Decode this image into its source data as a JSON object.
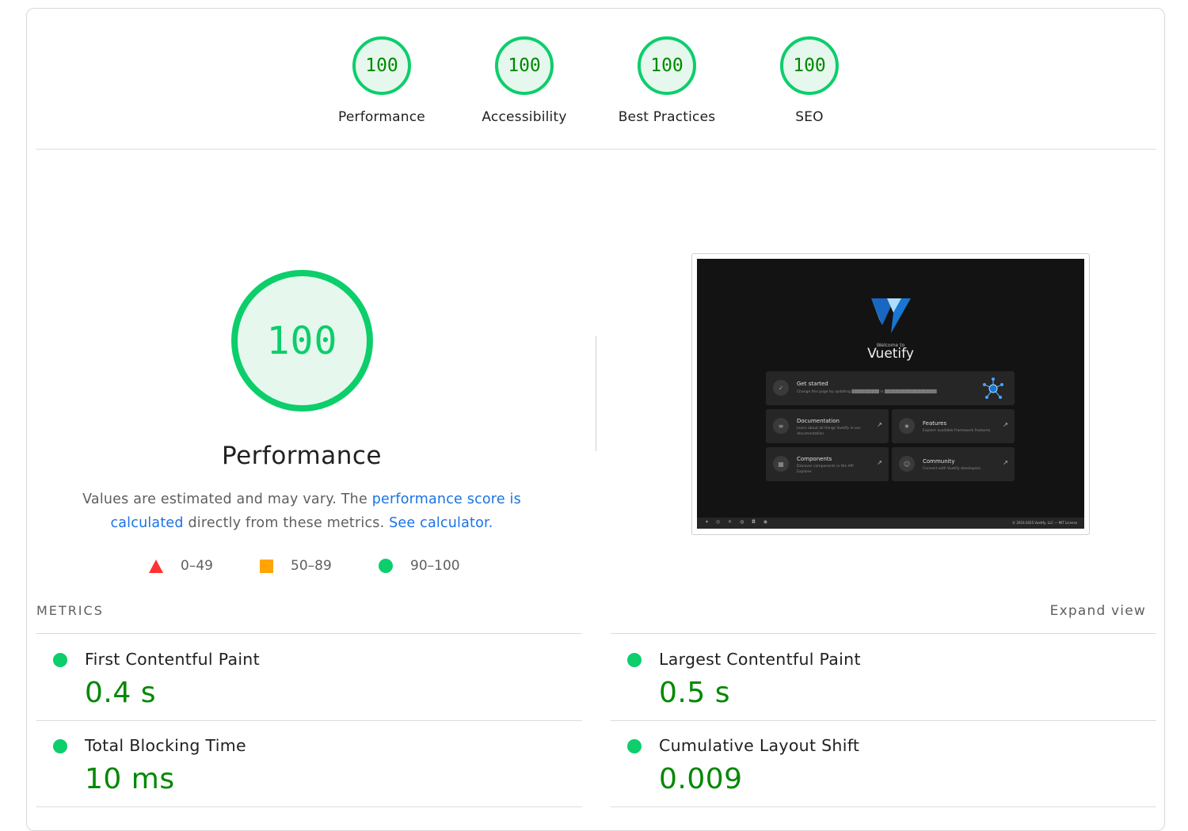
{
  "gauges": [
    {
      "score": "100",
      "label": "Performance"
    },
    {
      "score": "100",
      "label": "Accessibility"
    },
    {
      "score": "100",
      "label": "Best Practices"
    },
    {
      "score": "100",
      "label": "SEO"
    }
  ],
  "main": {
    "score": "100",
    "title": "Performance",
    "desc_text1": "Values are estimated and may vary. The ",
    "desc_link1": "performance score is calculated",
    "desc_text2": " directly from these metrics. ",
    "desc_link2": "See calculator."
  },
  "legend": [
    {
      "range": "0–49",
      "color": "#ff3333",
      "shape": "triangle"
    },
    {
      "range": "50–89",
      "color": "#ffa400",
      "shape": "square"
    },
    {
      "range": "90–100",
      "color": "#0cce6b",
      "shape": "circle"
    }
  ],
  "screenshot": {
    "welcome": "Welcome to",
    "brand": "Vuetify",
    "cards": [
      {
        "title": "Get started",
        "subtitle": "Change this page by updating ▓▓▓▓▓▓▓▓▓▓ in ▓▓▓▓▓▓▓▓▓▓▓▓▓▓▓▓▓▓▓",
        "icon": "check-icon"
      },
      {
        "title": "Documentation",
        "subtitle": "Learn about all things Vuetify in our documentation.",
        "icon": "document-icon"
      },
      {
        "title": "Features",
        "subtitle": "Explore available framework Features.",
        "icon": "star-icon"
      },
      {
        "title": "Components",
        "subtitle": "Discover components in the API Explorer.",
        "icon": "grid-icon"
      },
      {
        "title": "Community",
        "subtitle": "Connect with Vuetify developers.",
        "icon": "people-icon"
      }
    ],
    "footer_icons": "▾ ◎ ✕ ◍ ◘ ◉",
    "footer_copy": "© 2016-2025 Vuetify, LLC — MIT License"
  },
  "metrics": {
    "title": "METRICS",
    "expand_label": "Expand view",
    "items": [
      {
        "label": "First Contentful Paint",
        "value": "0.4 s",
        "status": "pass"
      },
      {
        "label": "Largest Contentful Paint",
        "value": "0.5 s",
        "status": "pass"
      },
      {
        "label": "Total Blocking Time",
        "value": "10 ms",
        "status": "pass"
      },
      {
        "label": "Cumulative Layout Shift",
        "value": "0.009",
        "status": "pass"
      }
    ]
  },
  "colors": {
    "pass": "#0cce6b",
    "pass_text": "#008800",
    "average": "#ffa400",
    "fail": "#ff3333",
    "link": "#1a73e8"
  }
}
